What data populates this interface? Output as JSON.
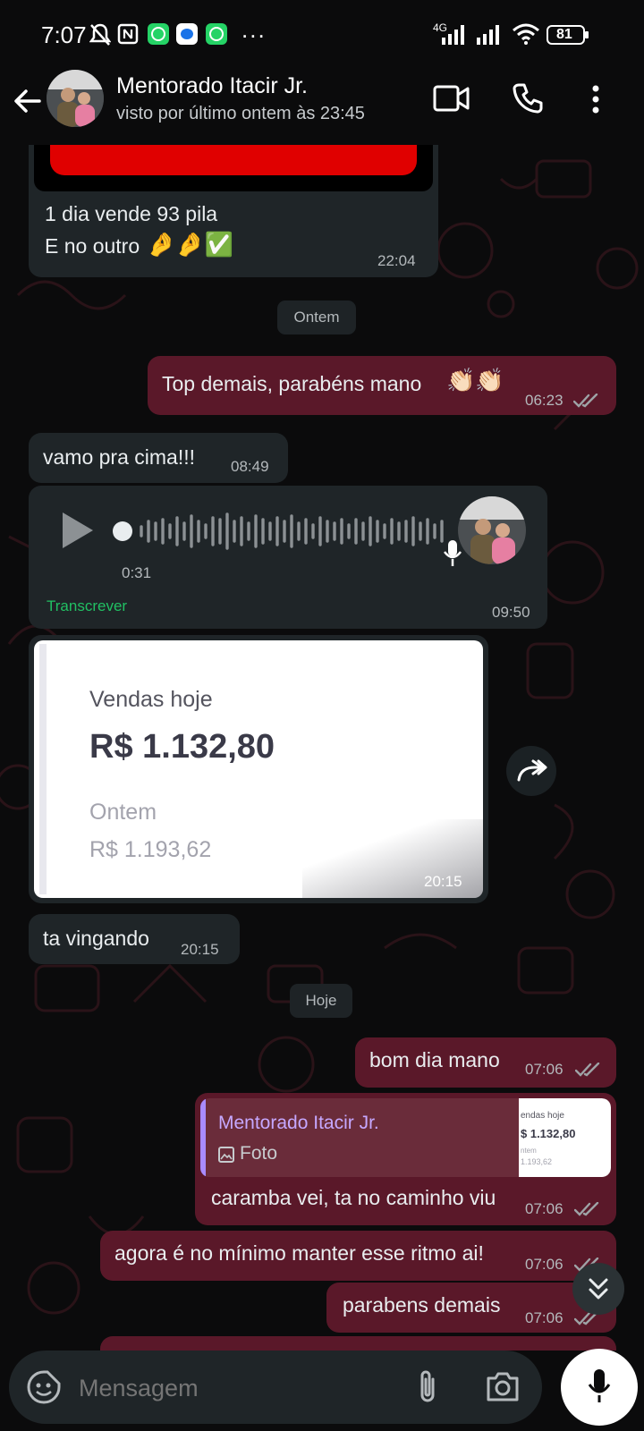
{
  "status_bar": {
    "time": "7:07",
    "network": "4G",
    "battery": "81",
    "more": "..."
  },
  "header": {
    "contact_name": "Mentorado Itacir Jr.",
    "last_seen": "visto por último ontem às 23:45"
  },
  "messages": {
    "m1": {
      "line1": "1 dia vende 93 pila",
      "line2": "E no outro",
      "emojis": "🤌🤌✅",
      "time": "22:04"
    },
    "divider_yesterday": "Ontem",
    "m2": {
      "text": "Top demais, parabéns mano",
      "emojis": "👏🏻👏🏻",
      "time": "06:23"
    },
    "m3": {
      "text": "vamo pra cima!!!",
      "time": "08:49"
    },
    "voice": {
      "duration": "0:31",
      "transcribe": "Transcrever",
      "time": "09:50"
    },
    "image": {
      "label_today": "Vendas hoje",
      "value_today": "R$ 1.132,80",
      "label_yesterday": "Ontem",
      "value_yesterday": "R$ 1.193,62",
      "time": "20:15"
    },
    "m4": {
      "text": "ta vingando",
      "time": "20:15"
    },
    "divider_today": "Hoje",
    "m5": {
      "text": "bom dia mano",
      "time": "07:06"
    },
    "m6": {
      "quote_name": "Mentorado Itacir Jr.",
      "quote_type": "Foto",
      "quote_thumb_title": "endas hoje",
      "quote_thumb_value": "$ 1.132,80",
      "quote_thumb_sub": "ntem",
      "quote_thumb_sub_value": "1.193,62",
      "text": "caramba vei, ta no caminho viu",
      "time": "07:06"
    },
    "m7": {
      "text": "agora é no mínimo manter esse ritmo ai!",
      "time": "07:06"
    },
    "m8": {
      "text": "parabens demais",
      "time": "07:06"
    }
  },
  "composer": {
    "placeholder": "Mensagem"
  },
  "colors": {
    "incoming": "#1f2528",
    "outgoing": "#5a1829",
    "accent_green": "#21c063",
    "quote_name": "#c6a8ff",
    "top_red_image": "#e00000"
  }
}
